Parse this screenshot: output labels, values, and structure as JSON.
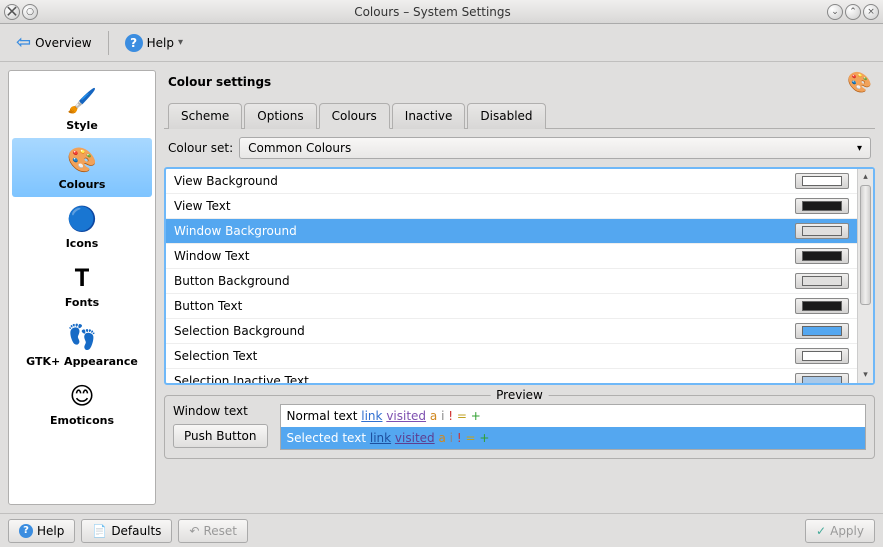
{
  "window": {
    "title": "Colours – System Settings"
  },
  "toolbar": {
    "overview": "Overview",
    "help": "Help"
  },
  "sidebar": {
    "items": [
      {
        "label": "Style",
        "icon": "🖌️"
      },
      {
        "label": "Colours",
        "icon": "🎨"
      },
      {
        "label": "Icons",
        "icon": "🔵"
      },
      {
        "label": "Fonts",
        "icon": "𝐓"
      },
      {
        "label": "GTK+ Appearance",
        "icon": "👣"
      },
      {
        "label": "Emoticons",
        "icon": "😊"
      }
    ]
  },
  "content": {
    "title": "Colour settings"
  },
  "tabs": {
    "items": [
      "Scheme",
      "Options",
      "Colours",
      "Inactive",
      "Disabled"
    ],
    "active": 2
  },
  "colour_set": {
    "label": "Colour set:",
    "value": "Common Colours"
  },
  "colours": [
    {
      "name": "View Background",
      "value": "#ffffff"
    },
    {
      "name": "View Text",
      "value": "#1a1a1a"
    },
    {
      "name": "Window Background",
      "value": "#e0dfde",
      "selected": true
    },
    {
      "name": "Window Text",
      "value": "#1a1a1a"
    },
    {
      "name": "Button Background",
      "value": "#e0dfde"
    },
    {
      "name": "Button Text",
      "value": "#1a1a1a"
    },
    {
      "name": "Selection Background",
      "value": "#54a7f0"
    },
    {
      "name": "Selection Text",
      "value": "#ffffff"
    },
    {
      "name": "Selection Inactive Text",
      "value": "#a8c8e8"
    }
  ],
  "preview": {
    "legend": "Preview",
    "window_text": "Window text",
    "push_button": "Push Button",
    "normal_prefix": "Normal text",
    "selected_prefix": "Selected text",
    "link": "link",
    "visited": "visited",
    "a": "a",
    "i": "i",
    "neg": "!",
    "neu": "=",
    "pos": "+"
  },
  "bottom": {
    "help": "Help",
    "defaults": "Defaults",
    "reset": "Reset",
    "apply": "Apply"
  }
}
